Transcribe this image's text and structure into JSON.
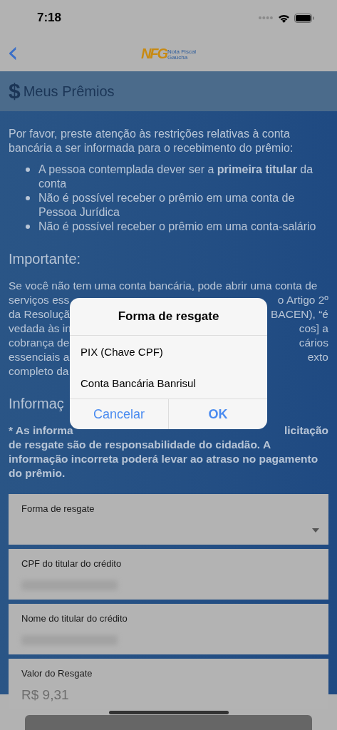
{
  "status_bar": {
    "time": "7:18"
  },
  "nav": {
    "back": "‹",
    "logo": {
      "mark": "NFG",
      "line1": "Nota Fiscal",
      "line2": "Gaúcha"
    }
  },
  "header": {
    "icon": "$",
    "title": "Meus Prêmios"
  },
  "intro": "Por favor, preste atenção às restrições relativas à conta bancária a ser informada para o recebimento do prêmio:",
  "bullets": [
    "A pessoa contemplada dever ser a **primeira titular** da conta",
    "Não é possível receber o prêmio em uma conta de Pessoa Jurídica",
    "Não é possível receber o prêmio em uma conta-salário"
  ],
  "important_heading": "Importante:",
  "important_lines": [
    {
      "left": "Se você não tem uma conta bancária, pode abrir uma conta de"
    },
    {
      "left": "serviços ess",
      "right": "o Artigo 2º"
    },
    {
      "left": "da Resoluçã",
      "right": "BACEN), “é"
    },
    {
      "left": "vedada às in",
      "right": "cos] a"
    },
    {
      "left": "cobrança de",
      "right": "cários"
    },
    {
      "left": "essenciais a",
      "right": "exto"
    },
    {
      "left": "completo da"
    }
  ],
  "info_heading": "Informaç",
  "info_lines": [
    {
      "left": "* As informa",
      "right": "licitação"
    },
    {
      "left": "de resgate são de responsabilidade do cidadão. A"
    },
    {
      "left": "informação incorreta poderá levar ao atraso no pagamento"
    },
    {
      "left": "do prêmio."
    }
  ],
  "fields": [
    {
      "kind": "select",
      "label": "Forma de resgate"
    },
    {
      "kind": "masked",
      "label": "CPF do titular do crédito"
    },
    {
      "kind": "masked",
      "label": "Nome do titular do crédito"
    },
    {
      "kind": "text",
      "label": "Valor do Resgate",
      "value": "R$ 9,31"
    }
  ],
  "dialog": {
    "title": "Forma de resgate",
    "options": [
      "PIX (Chave CPF)",
      "Conta Bancária Banrisul"
    ],
    "buttons": [
      {
        "label": "Cancelar",
        "kind": "cancel"
      },
      {
        "label": "OK",
        "kind": "default"
      }
    ]
  }
}
